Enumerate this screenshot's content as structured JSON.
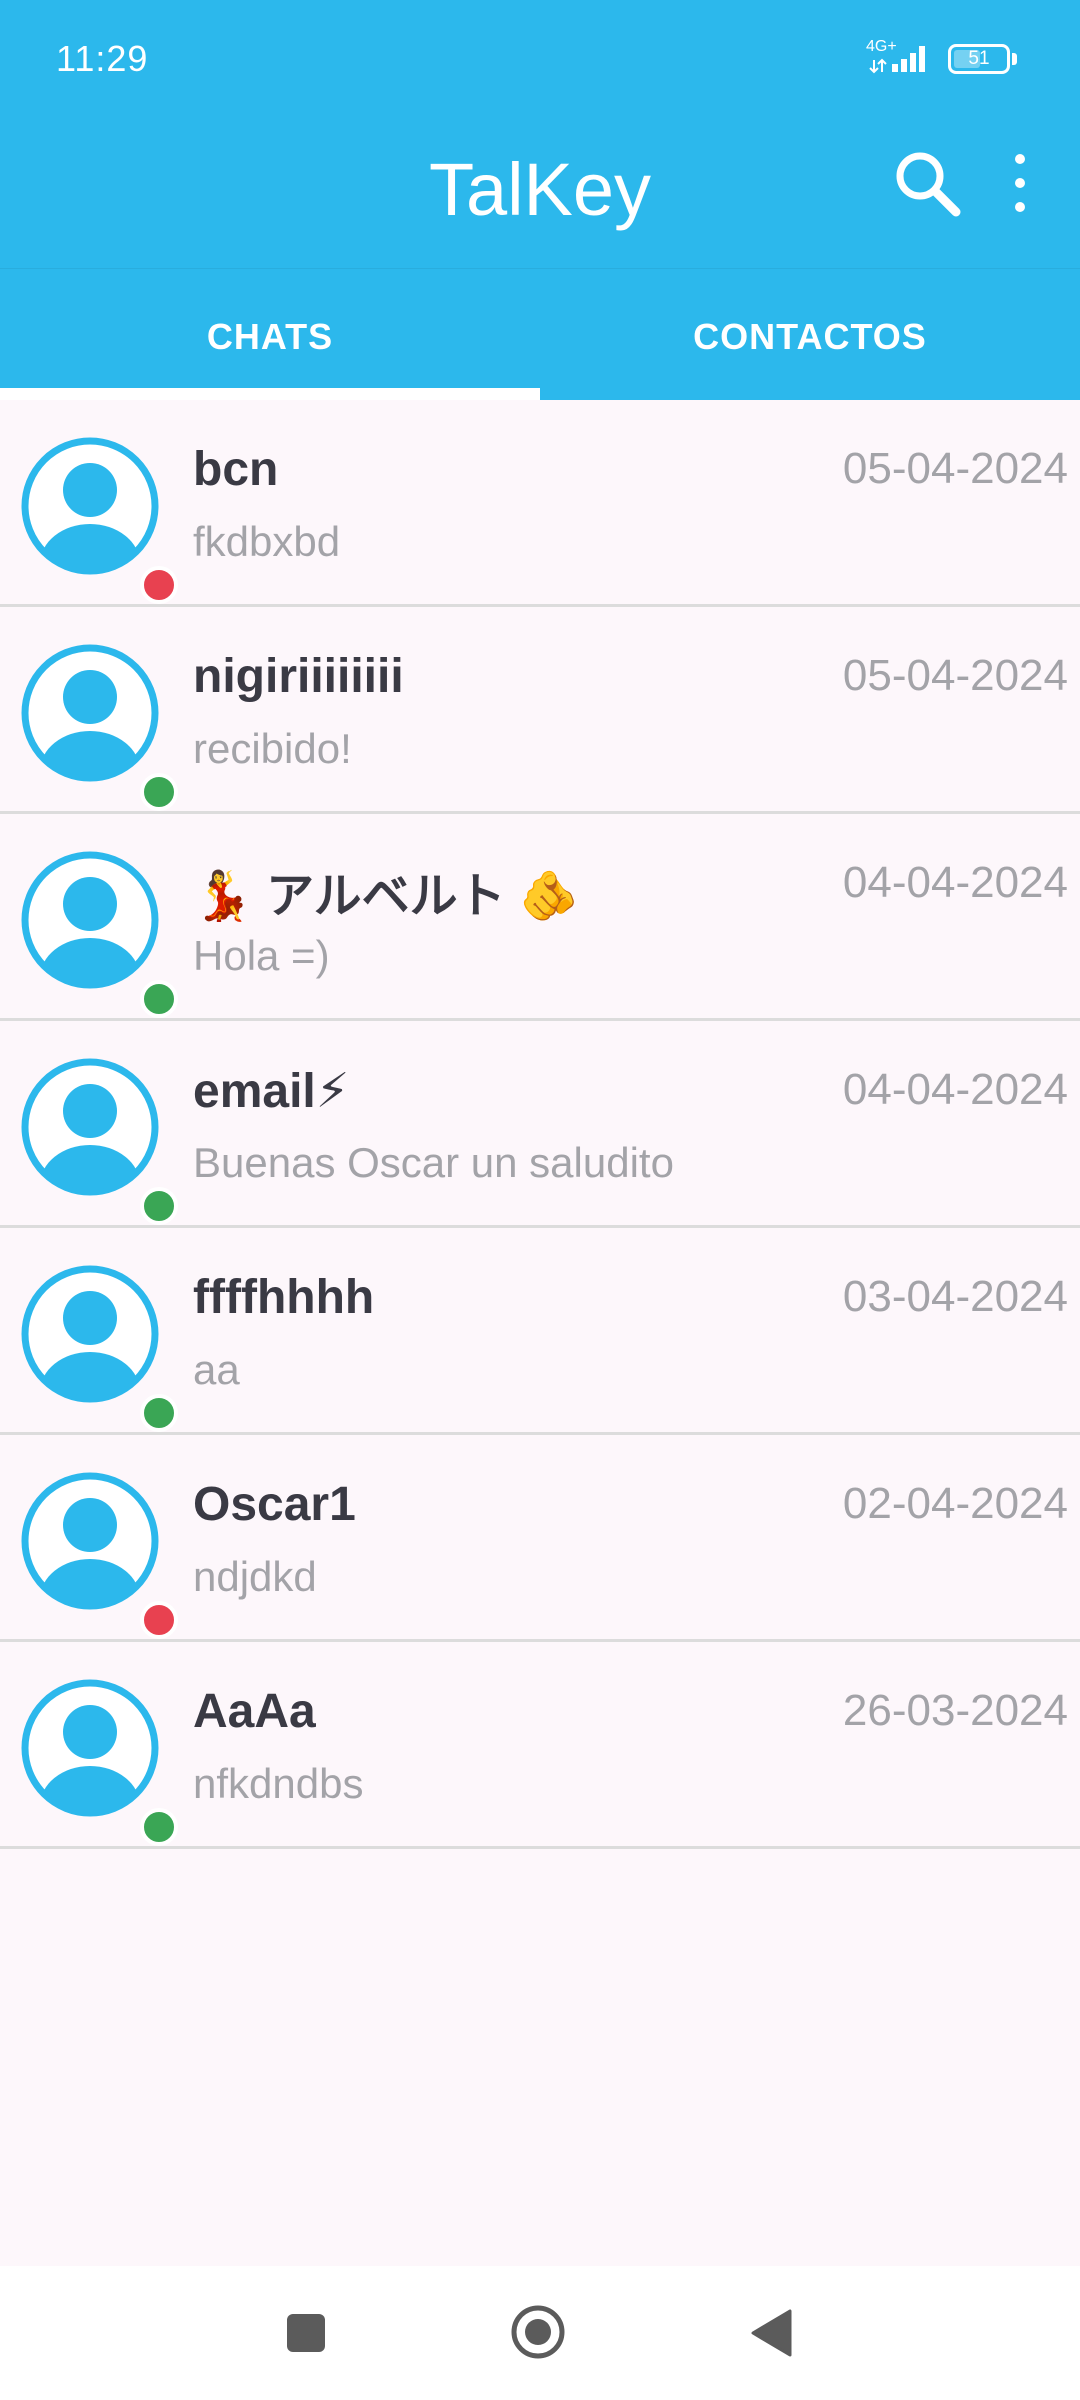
{
  "status_bar": {
    "time": "11:29",
    "network": "4G+",
    "battery": "51",
    "battery_level": 0.51
  },
  "app_bar": {
    "title": "TalKey",
    "search_icon": "search-icon",
    "more_icon": "more-vert-icon"
  },
  "tabs": [
    {
      "label": "CHATS",
      "selected": true
    },
    {
      "label": "CONTACTOS",
      "selected": false
    }
  ],
  "colors": {
    "primary": "#2cb8ec",
    "online": "#3aa655",
    "offline": "#e84150",
    "background": "#fdf7fb",
    "name_text": "#3a3a44",
    "secondary_text": "#a3a3a8"
  },
  "chats": [
    {
      "name": "bcn",
      "last_message": "fkdbxbd",
      "date": "05-04-2024",
      "status": "offline"
    },
    {
      "name": "nigiriiiiiiii",
      "last_message": "recibido!",
      "date": "05-04-2024",
      "status": "online"
    },
    {
      "name": "💃 アルベルト 🫵",
      "last_message": "Hola =)",
      "date": "04-04-2024",
      "status": "online"
    },
    {
      "name": "email⚡",
      "last_message": "Buenas Oscar un saludito",
      "date": "04-04-2024",
      "status": "online"
    },
    {
      "name": "ffffhhhh",
      "last_message": "aa",
      "date": "03-04-2024",
      "status": "online"
    },
    {
      "name": "Oscar1",
      "last_message": "ndjdkd",
      "date": "02-04-2024",
      "status": "offline"
    },
    {
      "name": "AaAa",
      "last_message": "nfkdndbs",
      "date": "26-03-2024",
      "status": "online"
    }
  ],
  "nav_bar": {
    "recents_icon": "recents-icon",
    "home_icon": "home-icon",
    "back_icon": "back-icon"
  }
}
